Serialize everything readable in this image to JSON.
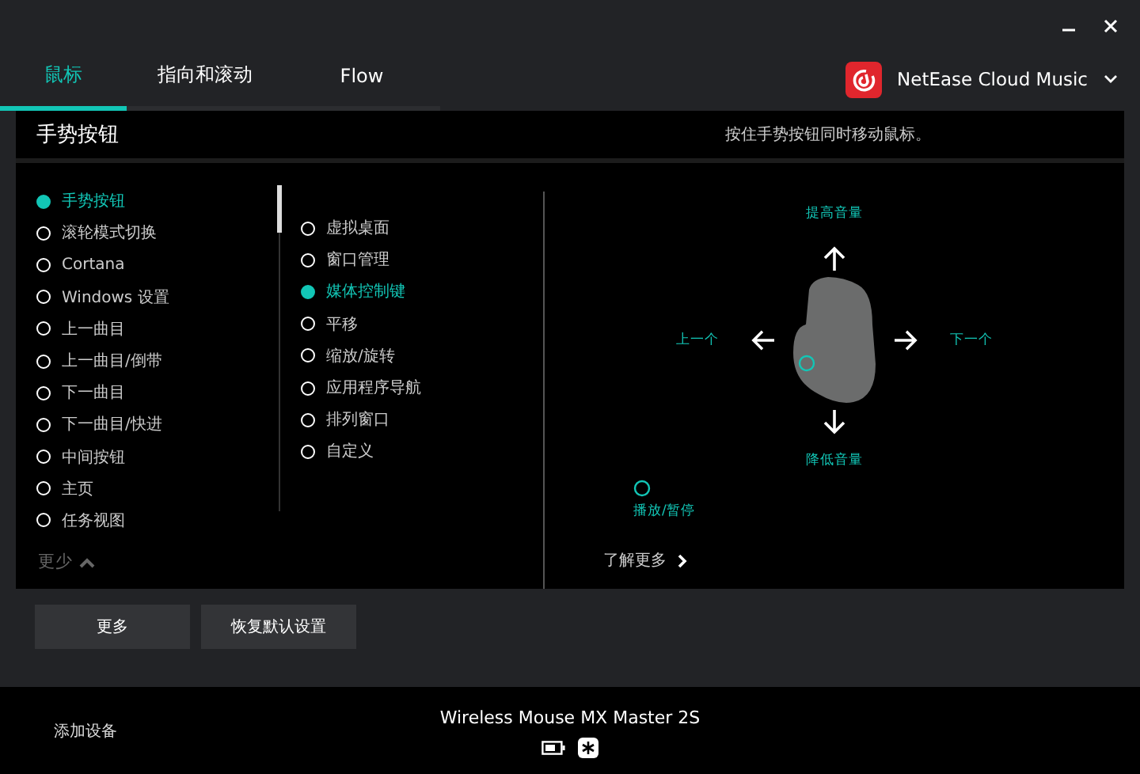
{
  "tabs": [
    {
      "label": "鼠标",
      "selected": true
    },
    {
      "label": "指向和滚动",
      "selected": false
    },
    {
      "label": "Flow",
      "selected": false
    }
  ],
  "app_selector": {
    "label": "NetEase Cloud Music"
  },
  "panel": {
    "title": "手势按钮",
    "hint": "按住手势按钮同时移动鼠标。",
    "buttons_list": [
      {
        "label": "手势按钮",
        "selected": true
      },
      {
        "label": "滚轮模式切换",
        "selected": false
      },
      {
        "label": "Cortana",
        "selected": false
      },
      {
        "label": "Windows 设置",
        "selected": false
      },
      {
        "label": "上一曲目",
        "selected": false
      },
      {
        "label": "上一曲目/倒带",
        "selected": false
      },
      {
        "label": "下一曲目",
        "selected": false
      },
      {
        "label": "下一曲目/快进",
        "selected": false
      },
      {
        "label": "中间按钮",
        "selected": false
      },
      {
        "label": "主页",
        "selected": false
      },
      {
        "label": "任务视图",
        "selected": false
      }
    ],
    "less_link": "更少",
    "gesture_modes": [
      {
        "label": "虚拟桌面",
        "selected": false
      },
      {
        "label": "窗口管理",
        "selected": false
      },
      {
        "label": "媒体控制键",
        "selected": true
      },
      {
        "label": "平移",
        "selected": false
      },
      {
        "label": "缩放/旋转",
        "selected": false
      },
      {
        "label": "应用程序导航",
        "selected": false
      },
      {
        "label": "排列窗口",
        "selected": false
      },
      {
        "label": "自定义",
        "selected": false
      }
    ],
    "gestures": [
      {
        "kind": "up",
        "label": "提高音量"
      },
      {
        "kind": "left",
        "label": "上一个"
      },
      {
        "kind": "right",
        "label": "下一个"
      },
      {
        "kind": "down",
        "label": "降低音量"
      }
    ],
    "click_action": "播放/暂停",
    "learn_more": "了解更多"
  },
  "buttons": [
    "更多",
    "恢复默认设置"
  ],
  "footer": {
    "add_device": "添加设备",
    "device_name": "Wireless Mouse MX Master 2S"
  }
}
